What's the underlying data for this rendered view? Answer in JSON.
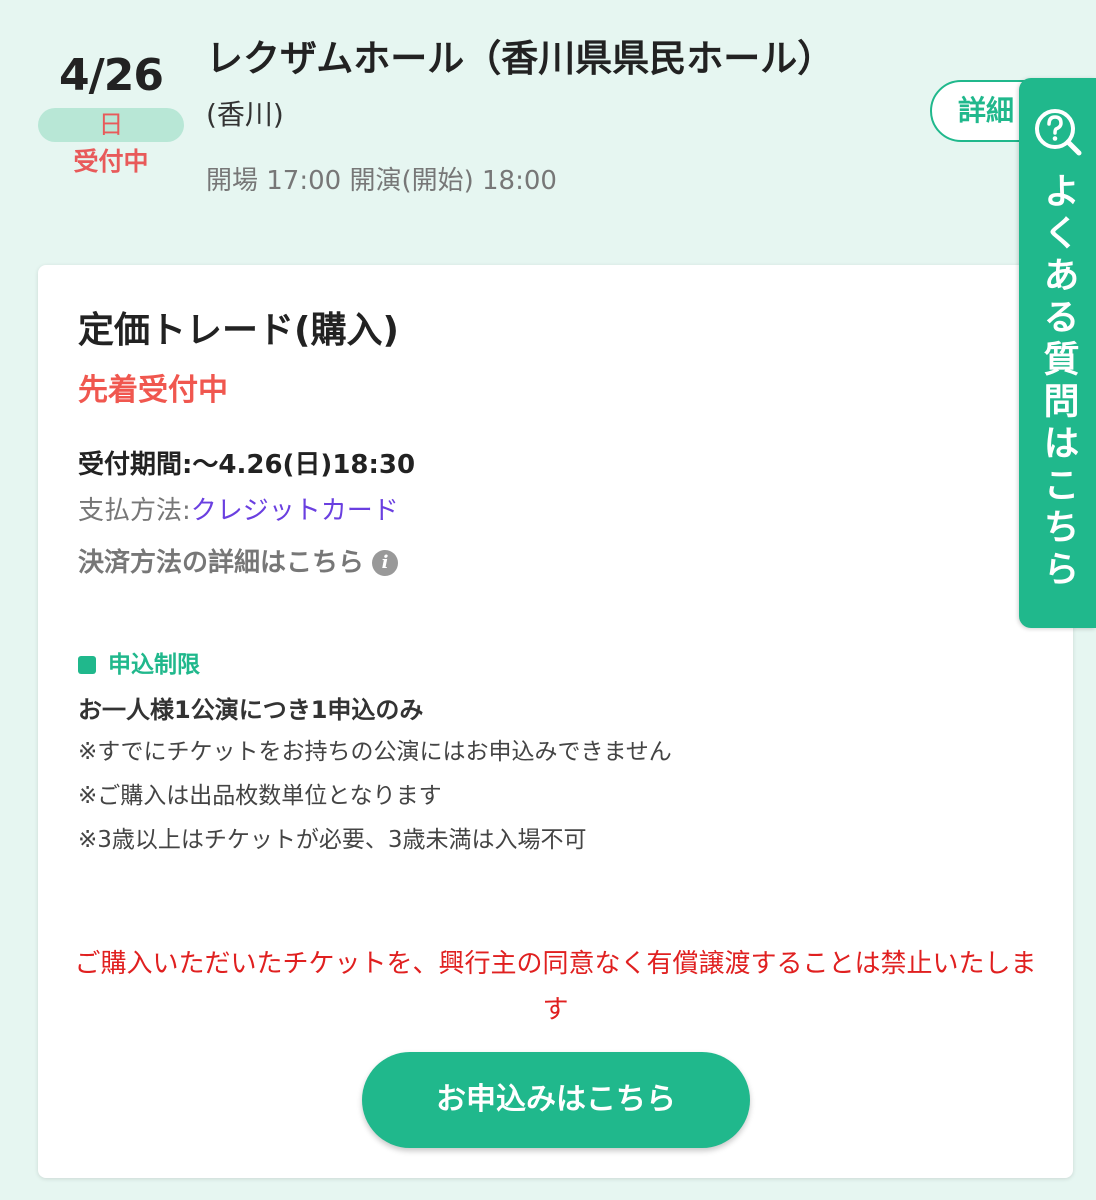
{
  "event": {
    "date": "4/26",
    "weekday": "日",
    "status": "受付中",
    "venue_name": "レクザムホール（香川県県民ホール）",
    "venue_prefecture": "(香川)",
    "time_info": "開場 17:00 開演(開始) 18:00",
    "detail_button_label": "詳細"
  },
  "trade": {
    "title": "定価トレード(購入)",
    "status": "先着受付中",
    "period": "受付期間:〜4.26(日)18:30",
    "payment_label": "支払方法:",
    "payment_value": "クレジットカード",
    "settlement_link": "決済方法の詳細はこちら",
    "info_icon_glyph": "i",
    "limit_label": "申込制限",
    "limit_main": "お一人様1公演につき1申込のみ",
    "notes": [
      "※すでにチケットをお持ちの公演にはお申込みできません",
      "※ご購入は出品枚数単位となります",
      "※3歳以上はチケットが必要、3歳未満は入場不可"
    ],
    "warning": "ご購入いただいたチケットを、興行主の同意なく有償譲渡することは禁止いたします",
    "apply_button_label": "お申込みはこちら"
  },
  "faq_tab": {
    "label": "よくある質問はこちら",
    "icon": "question-search-icon"
  },
  "colors": {
    "accent": "#20b88c",
    "background": "#e6f6f1",
    "status_red": "#f0574f",
    "warning_red": "#e02020",
    "link_purple": "#6a3fe0"
  }
}
